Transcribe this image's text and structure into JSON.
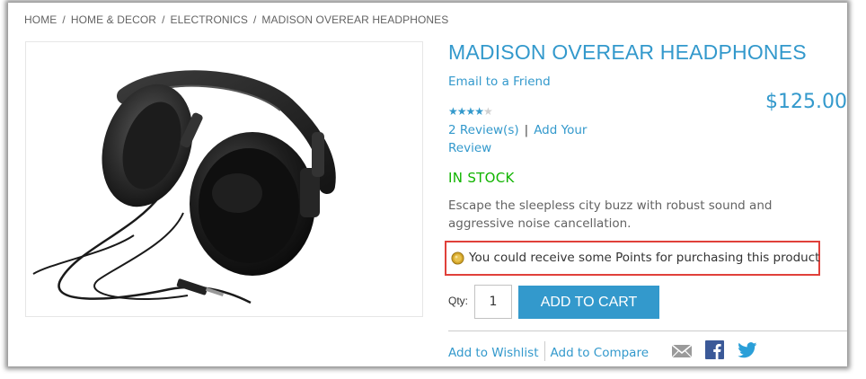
{
  "breadcrumb": {
    "items": [
      "HOME",
      "HOME & DECOR",
      "ELECTRONICS"
    ],
    "current": "MADISON OVEREAR HEADPHONES",
    "separator": "/"
  },
  "product": {
    "title": "MADISON OVEREAR HEADPHONES",
    "email_link": "Email to a Friend",
    "price": "$125.00",
    "rating": {
      "stars_filled": 4,
      "stars_total": 5
    },
    "reviews_link": "2 Review(s)",
    "review_separator": "|",
    "add_review_link": "Add Your Review",
    "stock": "IN STOCK",
    "description": "Escape the sleepless city buzz with robust sound and aggressive noise cancellation.",
    "image_alt": "headphones"
  },
  "points": {
    "message": "You could receive some Points for purchasing this product",
    "icon": "coin-icon"
  },
  "cart": {
    "qty_label": "Qty:",
    "qty_value": "1",
    "add_to_cart_label": "ADD TO CART"
  },
  "actions": {
    "wishlist_label": "Add to Wishlist",
    "compare_label": "Add to Compare",
    "icons": [
      "mail-icon",
      "facebook-icon",
      "twitter-icon"
    ]
  },
  "colors": {
    "accent": "#3399cc",
    "stock_green": "#11b400",
    "highlight_border": "#e0403a",
    "facebook": "#3b5998",
    "twitter": "#1da1f2"
  }
}
